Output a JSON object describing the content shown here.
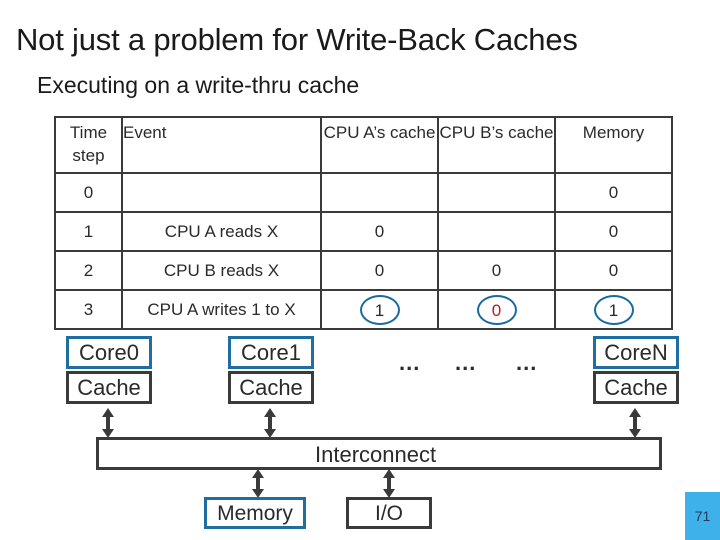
{
  "slide": {
    "title": "Not just a problem for Write-Back Caches",
    "subtitle": "Executing on a write-thru cache",
    "page_number": "71"
  },
  "table": {
    "headers": {
      "step": "Time step",
      "event": "Event",
      "cache_a": "CPU A’s cache",
      "cache_b": "CPU B’s cache",
      "memory": "Memory"
    },
    "rows": [
      {
        "step": "0",
        "event": "",
        "cache_a": "",
        "cache_b": "",
        "memory": "0"
      },
      {
        "step": "1",
        "event": "CPU A reads X",
        "cache_a": "0",
        "cache_b": "",
        "memory": "0"
      },
      {
        "step": "2",
        "event": "CPU B reads X",
        "cache_a": "0",
        "cache_b": "0",
        "memory": "0"
      },
      {
        "step": "3",
        "event": "CPU A writes 1 to X",
        "cache_a": "1",
        "cache_b": "0",
        "memory": "1"
      }
    ],
    "highlight": {
      "circle_color": "#1a6aa0",
      "stale_value_color": "#c0181e"
    }
  },
  "diagram": {
    "cores": [
      {
        "core": "Core0",
        "cache": "Cache"
      },
      {
        "core": "Core1",
        "cache": "Cache"
      },
      {
        "core": "CoreN",
        "cache": "Cache"
      }
    ],
    "ellipsis": [
      "...",
      "...",
      "..."
    ],
    "interconnect": "Interconnect",
    "memory": "Memory",
    "io": "I/O",
    "colors": {
      "core_border": "#1f6ea3",
      "box_border": "#3a3a3a",
      "page_badge": "#3fb1ea"
    }
  }
}
